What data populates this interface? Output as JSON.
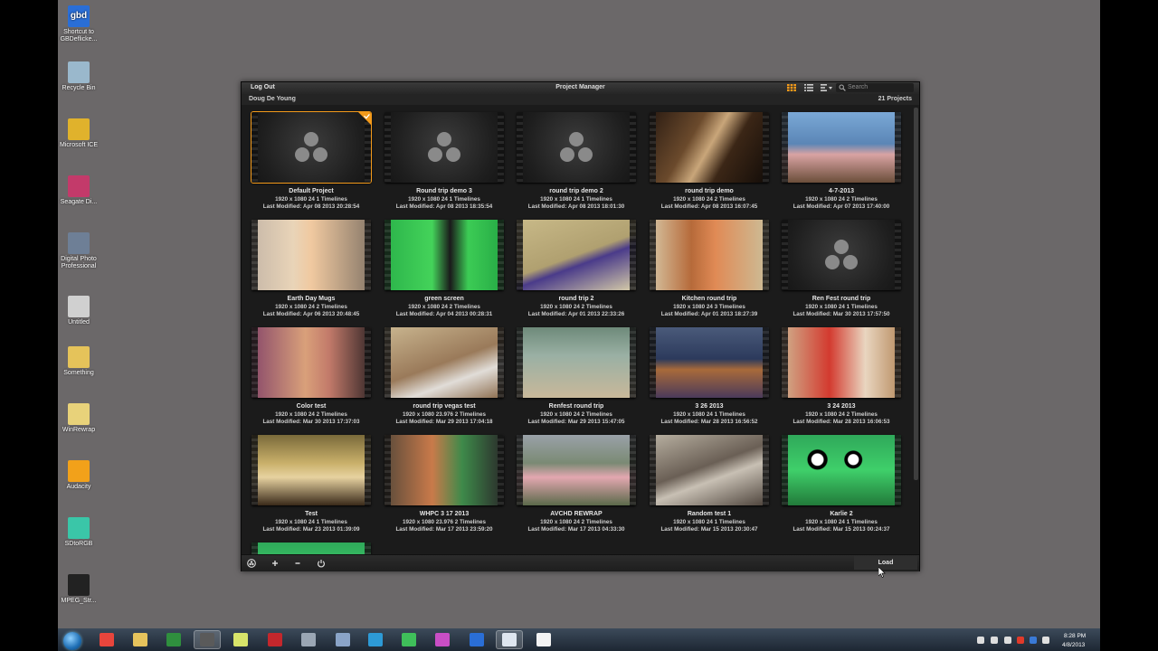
{
  "desktop": {
    "icons": [
      {
        "label_1": "Shortcut to",
        "label_2": "GBDeflicke...",
        "glyph": "gbd",
        "color": "#2a6ed6"
      },
      {
        "label_1": "Recycle Bin",
        "label_2": "",
        "glyph": "",
        "color": "#9ab8cc"
      },
      {
        "label_1": "Microsoft ICE",
        "label_2": "",
        "glyph": "",
        "color": "#e0b22c"
      },
      {
        "label_1": "Seagate Di...",
        "label_2": "",
        "glyph": "",
        "color": "#c33a6a"
      },
      {
        "label_1": "Digital Photo",
        "label_2": "Professional",
        "glyph": "",
        "color": "#6e7f96"
      },
      {
        "label_1": "Untitled",
        "label_2": "",
        "glyph": "",
        "color": "#d0d0d0"
      },
      {
        "label_1": "Something",
        "label_2": "",
        "glyph": "",
        "color": "#e5c35a"
      },
      {
        "label_1": "WinRewrap",
        "label_2": "",
        "glyph": "",
        "color": "#e8d27a"
      },
      {
        "label_1": "Audacity",
        "label_2": "",
        "glyph": "",
        "color": "#f2a11a"
      },
      {
        "label_1": "SDtoRGB",
        "label_2": "",
        "glyph": "",
        "color": "#3ac6a8"
      },
      {
        "label_1": "MPEG_Str...",
        "label_2": "",
        "glyph": "",
        "color": "#222"
      }
    ]
  },
  "window": {
    "logout_label": "Log Out",
    "title": "Project Manager",
    "search_placeholder": "Search",
    "user": "Doug De Young",
    "project_count": "21 Projects",
    "load_label": "Load"
  },
  "projects": [
    {
      "name": "Default Project",
      "res": "1920 x 1080 24 1 Timelines",
      "modified": "Last Modified: Apr 08 2013 20:28:54",
      "thumb": "logo",
      "selected": true
    },
    {
      "name": "Round trip demo 3",
      "res": "1920 x 1080 24 1 Timelines",
      "modified": "Last Modified: Apr 08 2013 18:35:54",
      "thumb": "logo"
    },
    {
      "name": "round trip demo 2",
      "res": "1920 x 1080 24 1 Timelines",
      "modified": "Last Modified: Apr 08 2013 18:01:30",
      "thumb": "logo"
    },
    {
      "name": "round trip demo",
      "res": "1920 x 1080 24 2 Timelines",
      "modified": "Last Modified: Apr 08 2013 16:07:45",
      "thumb": "guitar"
    },
    {
      "name": "4-7-2013",
      "res": "1920 x 1080 24 2 Timelines",
      "modified": "Last Modified: Apr 07 2013 17:40:00",
      "thumb": "singer"
    },
    {
      "name": "Earth Day Mugs",
      "res": "1920 x 1080 24 2 Timelines",
      "modified": "Last Modified: Apr 06 2013 20:48:45",
      "thumb": "woman"
    },
    {
      "name": "green screen",
      "res": "1920 x 1080 24 2 Timelines",
      "modified": "Last Modified: Apr 04 2013 00:28:31",
      "thumb": "green"
    },
    {
      "name": "round trip 2",
      "res": "1920 x 1080 24 2 Timelines",
      "modified": "Last Modified: Apr 01 2013 22:33:26",
      "thumb": "table"
    },
    {
      "name": "Kitchen round trip",
      "res": "1920 x 1080 24 3 Timelines",
      "modified": "Last Modified: Apr 01 2013 18:27:39",
      "thumb": "kitchen"
    },
    {
      "name": "Ren Fest round trip",
      "res": "1920 x 1080 24 1 Timelines",
      "modified": "Last Modified: Mar 30 2013 17:57:50",
      "thumb": "logo"
    },
    {
      "name": "Color test",
      "res": "1920 x 1080 24 2 Timelines",
      "modified": "Last Modified: Mar 30 2013 17:37:03",
      "thumb": "girl"
    },
    {
      "name": "round trip vegas test",
      "res": "1920 x 1080 23.976 2 Timelines",
      "modified": "Last Modified: Mar 29 2013 17:04:18",
      "thumb": "back"
    },
    {
      "name": "Renfest round trip",
      "res": "1920 x 1080 24 2 Timelines",
      "modified": "Last Modified: Mar 29 2013 15:47:05",
      "thumb": "fest"
    },
    {
      "name": "3 26 2013",
      "res": "1920 x 1080 24 1 Timelines",
      "modified": "Last Modified: Mar 28 2013 16:56:52",
      "thumb": "dog"
    },
    {
      "name": "3 24 2013",
      "res": "1920 x 1080 24 2 Timelines",
      "modified": "Last Modified: Mar 28 2013 16:06:53",
      "thumb": "redshirt"
    },
    {
      "name": "Test",
      "res": "1920 x 1080 24 1 Timelines",
      "modified": "Last Modified: Mar 23 2013 01:39:09",
      "thumb": "shelf"
    },
    {
      "name": "WHPC 3 17 2013",
      "res": "1920 x 1080 23.976 2 Timelines",
      "modified": "Last Modified: Mar 17 2013 23:59:20",
      "thumb": "phone"
    },
    {
      "name": "AVCHD REWRAP",
      "res": "1920 x 1080 24 2 Timelines",
      "modified": "Last Modified: Mar 17 2013 04:33:30",
      "thumb": "jump"
    },
    {
      "name": "Random test 1",
      "res": "1920 x 1080 24 1 Timelines",
      "modified": "Last Modified: Mar 15 2013 20:30:47",
      "thumb": "engine"
    },
    {
      "name": "Karlie 2",
      "res": "1920 x 1080 24 1 Timelines",
      "modified": "Last Modified: Mar 15 2013 00:24:37",
      "thumb": "frog"
    },
    {
      "name": "",
      "res": "",
      "modified": "",
      "thumb": "frog"
    }
  ],
  "taskbar": {
    "time": "8:28 PM",
    "date": "4/8/2013",
    "apps": [
      {
        "name": "chrome",
        "color": "#e8453c"
      },
      {
        "name": "explorer",
        "color": "#e6c35c"
      },
      {
        "name": "excel",
        "color": "#2f8f3e"
      },
      {
        "name": "resolve",
        "color": "#5a5a5a",
        "active": true
      },
      {
        "name": "folder",
        "color": "#d8e46a"
      },
      {
        "name": "app-red",
        "color": "#c4272c"
      },
      {
        "name": "photo",
        "color": "#9aa6b4"
      },
      {
        "name": "network",
        "color": "#8aa4c8"
      },
      {
        "name": "ie",
        "color": "#2d9ad6"
      },
      {
        "name": "skype",
        "color": "#3fbf5a"
      },
      {
        "name": "picasa",
        "color": "#c94ec5"
      },
      {
        "name": "gbd",
        "color": "#2a6ed6"
      },
      {
        "name": "window",
        "color": "#dfe6ef",
        "active": true
      },
      {
        "name": "notepad",
        "color": "#f3f3f3"
      }
    ]
  }
}
